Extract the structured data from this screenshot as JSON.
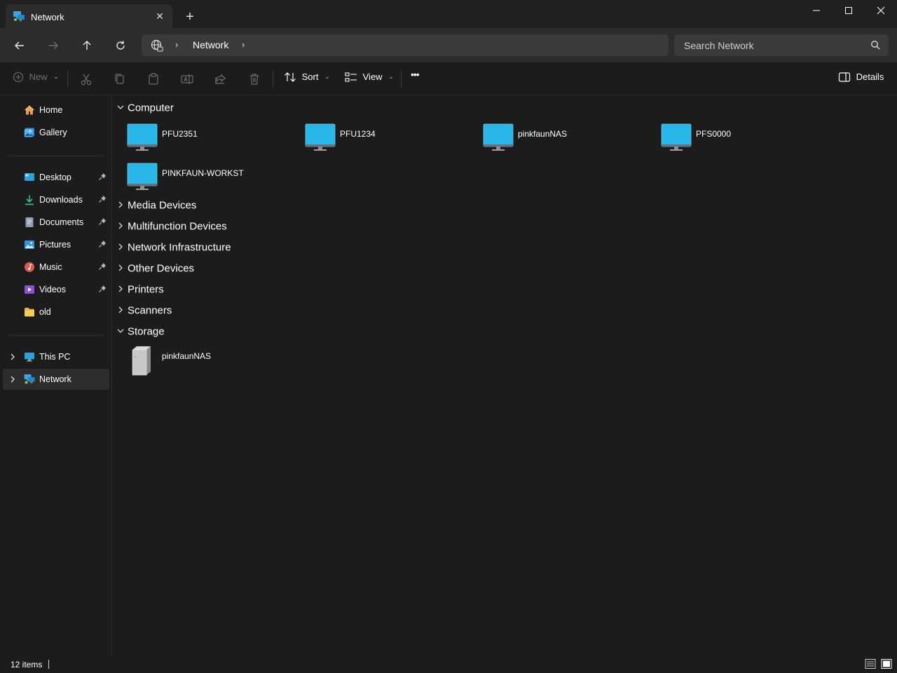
{
  "window": {
    "tab_title": "Network",
    "tab_close_glyph": "✕",
    "new_tab_glyph": "+",
    "minimize_glyph": "—",
    "maximize_glyph": "☐",
    "close_glyph": "✕"
  },
  "address": {
    "crumbs": [
      "Network"
    ],
    "search_placeholder": "Search Network"
  },
  "commands": {
    "new_label": "New",
    "sort_label": "Sort",
    "view_label": "View",
    "details_label": "Details",
    "more_glyph": "•••"
  },
  "sidebar": {
    "quick": [
      {
        "label": "Home",
        "icon": "home-icon"
      },
      {
        "label": "Gallery",
        "icon": "gallery-icon"
      }
    ],
    "pinned": [
      {
        "label": "Desktop",
        "icon": "desktop-icon",
        "pinned": true
      },
      {
        "label": "Downloads",
        "icon": "downloads-icon",
        "pinned": true
      },
      {
        "label": "Documents",
        "icon": "documents-icon",
        "pinned": true
      },
      {
        "label": "Pictures",
        "icon": "pictures-icon",
        "pinned": true
      },
      {
        "label": "Music",
        "icon": "music-icon",
        "pinned": true
      },
      {
        "label": "Videos",
        "icon": "videos-icon",
        "pinned": true
      },
      {
        "label": "old",
        "icon": "folder-icon",
        "pinned": false
      }
    ],
    "locations": [
      {
        "label": "This PC",
        "icon": "pc-icon",
        "selected": false
      },
      {
        "label": "Network",
        "icon": "network-icon",
        "selected": true
      }
    ]
  },
  "content": {
    "groups": [
      {
        "title": "Computer",
        "expanded": true,
        "items": [
          "PFU2351",
          "PFU1234",
          "pinkfaunNAS",
          "PFS0000",
          "PINKFAUN-WORKST"
        ]
      },
      {
        "title": "Media Devices",
        "expanded": false
      },
      {
        "title": "Multifunction Devices",
        "expanded": false
      },
      {
        "title": "Network Infrastructure",
        "expanded": false
      },
      {
        "title": "Other Devices",
        "expanded": false
      },
      {
        "title": "Printers",
        "expanded": false
      },
      {
        "title": "Scanners",
        "expanded": false
      },
      {
        "title": "Storage",
        "expanded": true,
        "items": [
          "pinkfaunNAS"
        ]
      }
    ]
  },
  "status": {
    "item_count": "12 items"
  },
  "colors": {
    "background": "#1c1c1c",
    "toolbar": "#2c2c2c",
    "monitor_accent": "#29b6e8",
    "selection": "#2d2d2d"
  }
}
